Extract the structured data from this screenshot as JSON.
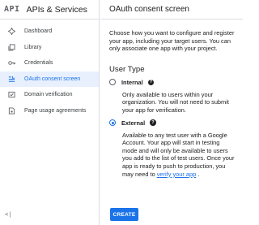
{
  "sidebar": {
    "logo": "API",
    "title": "APIs & Services",
    "items": [
      {
        "label": "Dashboard",
        "icon": "dashboard-icon",
        "active": false
      },
      {
        "label": "Library",
        "icon": "library-icon",
        "active": false
      },
      {
        "label": "Credentials",
        "icon": "key-icon",
        "active": false
      },
      {
        "label": "OAuth consent screen",
        "icon": "consent-list-icon",
        "active": true
      },
      {
        "label": "Domain verification",
        "icon": "domain-check-icon",
        "active": false
      },
      {
        "label": "Page usage agreements",
        "icon": "settings-page-icon",
        "active": false
      }
    ],
    "collapse_label": "<|"
  },
  "main": {
    "title": "OAuth consent screen",
    "intro": "Choose how you want to configure and register your app, including your target users. You can only associate one app with your project.",
    "user_type_title": "User Type",
    "options": [
      {
        "label": "Internal",
        "checked": false,
        "description": "Only available to users within your organization. You will not need to submit your app for verification."
      },
      {
        "label": "External",
        "checked": true,
        "description_prefix": "Available to any test user with a Google Account. Your app will start in testing mode and will only be available to users you add to the list of test users. Once your app is ready to push to production, you may need to ",
        "link_text": "verify your app",
        "description_suffix": " ."
      }
    ],
    "create_label": "CREATE"
  },
  "colors": {
    "accent": "#1a73e8",
    "active_bg": "#e8f0fe",
    "border": "#dadce0"
  }
}
